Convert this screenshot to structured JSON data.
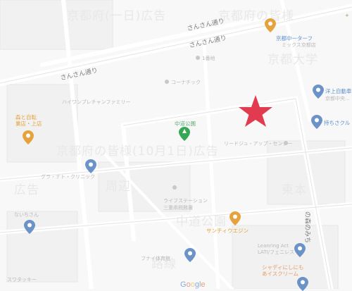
{
  "map": {
    "streets": [
      "さんさん通り",
      "さんさん通り",
      "さんさん通り"
    ],
    "street_top_upper": "さんさん通り",
    "street_top_lower": "さんさん通り",
    "street_left": "さんさん通り",
    "street_right": "の森のみち",
    "park_name": "中道公園",
    "place_names": {
      "tr_orange": "京都中一ターフ",
      "tr_orange_sub": "ミックス京都店",
      "right_blue": "洋上自動車",
      "right_blue_sub": "京都中央...",
      "right_blue2": "持ちさクル",
      "left_orange": "森と自転\n業店・上店",
      "left_blue_mid": "グラ・ナト・クリニック",
      "left_blue_bottom": "ないちさん",
      "bottom_orange": "サンチィウエジン",
      "bottom_blue_mid": "フナイ体育館",
      "bottom_right_blue": "Leanring Act\nLATI/フェニレス",
      "bottom_right_orange": "シャディにしにも\nあイスクリーム",
      "middle_label": "リードジュ・アップ・センター",
      "mid_small": "ライフステーション",
      "mid_small_sub": "三重県税務署",
      "top_small": "1番地",
      "nw_small": "コーナチック",
      "left_small": "ハイワンプレチャンファミリー",
      "bl_small": "スワタッキー",
      "top_right_tag": "+"
    },
    "ghost_texts": [
      "京都府(一日)広告",
      "京都府の皆様(10月1日)広告",
      "京都府の皆様",
      "中道公園",
      "広告",
      "東本",
      "京都大学",
      "周辺",
      "路線"
    ]
  },
  "attribution": {
    "logo_letters": [
      "G",
      "o",
      "o",
      "g",
      "l",
      "e"
    ]
  },
  "colors": {
    "marker": "#e23b4f",
    "park_pin": "#34a853",
    "blue_pin": "#6b93c8",
    "orange_pin": "#e6a23c"
  },
  "icons": [
    "star-marker-icon",
    "park-pin-icon",
    "place-pin-icon",
    "food-pin-icon"
  ]
}
